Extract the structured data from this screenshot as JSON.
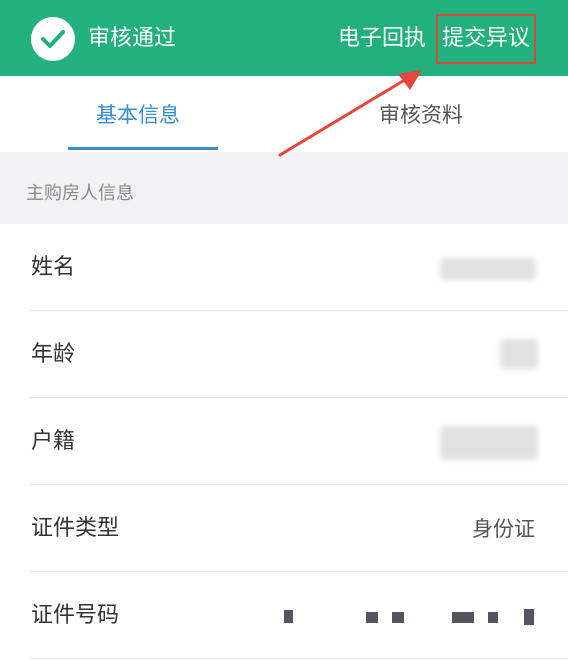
{
  "header": {
    "status_text": "审核通过",
    "receipt_link": "电子回执",
    "objection_button": "提交异议",
    "check_icon": "check-circle-icon",
    "background_color": "#22b17e",
    "highlight_border_color": "#d44a3a"
  },
  "tabs": {
    "basic_info": "基本信息",
    "review_docs": "审核资料",
    "active_color": "#3a8ed0"
  },
  "section": {
    "title": "主购房人信息"
  },
  "fields": {
    "name": {
      "label": "姓名",
      "value": ""
    },
    "age": {
      "label": "年龄",
      "value": ""
    },
    "household": {
      "label": "户籍",
      "value": ""
    },
    "id_type": {
      "label": "证件类型",
      "value": "身份证"
    },
    "id_number": {
      "label": "证件号码",
      "value": ""
    }
  },
  "annotation": {
    "arrow_color": "#e8453c"
  }
}
